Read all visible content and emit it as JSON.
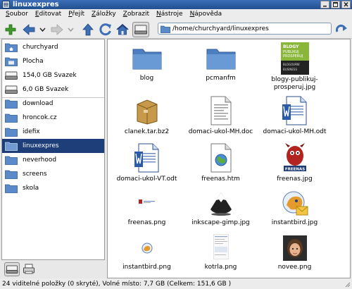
{
  "window": {
    "title": "linuxexpres"
  },
  "menu": [
    {
      "first": "S",
      "rest": "oubor"
    },
    {
      "first": "E",
      "rest": "ditovat"
    },
    {
      "first": "P",
      "rest": "řejít"
    },
    {
      "first": "Z",
      "rest": "áložky"
    },
    {
      "first": "Z",
      "rest": "obrazit"
    },
    {
      "first": "N",
      "rest": "ástroje"
    },
    {
      "first": "N",
      "rest": "ápověda"
    }
  ],
  "toolbar": {
    "path_value": "/home/churchyard/linuxexpres"
  },
  "sidebar": {
    "items": [
      {
        "label": "churchyard",
        "icon": "home-folder-icon"
      },
      {
        "label": "Plocha",
        "icon": "desktop-folder-icon"
      },
      {
        "label": "154,0 GB Svazek",
        "icon": "drive-icon"
      },
      {
        "label": "6,0 GB Svazek",
        "icon": "drive-icon"
      },
      {
        "label": "download",
        "icon": "folder-icon"
      },
      {
        "label": "hroncok.cz",
        "icon": "folder-icon"
      },
      {
        "label": "idefix",
        "icon": "folder-icon"
      },
      {
        "label": "linuxexpres",
        "icon": "folder-icon"
      },
      {
        "label": "neverhood",
        "icon": "folder-icon"
      },
      {
        "label": "screens",
        "icon": "folder-icon"
      },
      {
        "label": "skola",
        "icon": "folder-icon"
      }
    ],
    "selected": "linuxexpres"
  },
  "files": [
    {
      "name": "blog",
      "icon": "folder-icon"
    },
    {
      "name": "pcmanfm",
      "icon": "folder-icon"
    },
    {
      "name": "blogy-publikuj-\nprosperuj.jpg",
      "icon": "image-thumbnail-icon"
    },
    {
      "name": "clanek.tar.bz2",
      "icon": "archive-icon"
    },
    {
      "name": "domaci-ukol-MH.doc",
      "icon": "document-icon"
    },
    {
      "name": "domaci-ukol-MH.odt",
      "icon": "writer-document-icon"
    },
    {
      "name": "domaci-ukol-VT.odt",
      "icon": "writer-document-icon"
    },
    {
      "name": "freenas.htm",
      "icon": "html-icon"
    },
    {
      "name": "freenas.jpg",
      "icon": "image-thumbnail-icon"
    },
    {
      "name": "freenas.png",
      "icon": "image-thumbnail-icon"
    },
    {
      "name": "inkscape-gimp.jpg",
      "icon": "image-thumbnail-icon"
    },
    {
      "name": "instantbird.jpg",
      "icon": "image-thumbnail-icon"
    },
    {
      "name": "instantbird.png",
      "icon": "image-thumbnail-icon"
    },
    {
      "name": "kotrla.png",
      "icon": "image-thumbnail-icon"
    },
    {
      "name": "novee.png",
      "icon": "image-thumbnail-icon"
    }
  ],
  "thumb_texts": {
    "blogy": [
      "BLOGY",
      "PUBLIKUJ",
      "PROSPERUJ",
      "BLOGOVÁNÍ",
      "BUSINESS"
    ],
    "freenas": "FREENAS"
  },
  "statusbar": {
    "text": "24 viditelné položky (0 skryté), Volné místo: 7,7 GB (Celkem: 151,6 GB )"
  },
  "colors": {
    "selection": "#1e3e7a",
    "folder": "#5b8ac8",
    "titlebar": "#2b5ba3"
  }
}
